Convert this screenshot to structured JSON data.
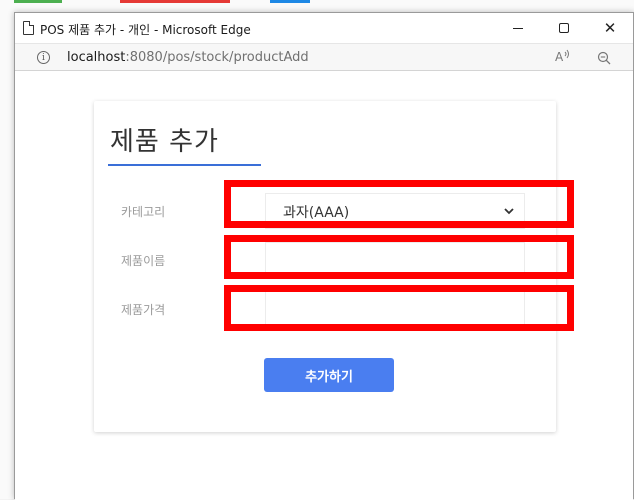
{
  "window": {
    "title": "POS 제품 추가 - 개인 - Microsoft Edge",
    "minimize_icon": "minimize-icon",
    "maximize_icon": "maximize-icon",
    "close_glyph": "✕"
  },
  "address": {
    "host": "localhost",
    "rest": ":8080/pos/stock/productAdd",
    "read_aloud_glyph": "A`",
    "info_glyph": "i"
  },
  "form": {
    "title": "제품 추가",
    "fields": [
      {
        "label": "카테고리",
        "type": "select",
        "value": "과자(AAA)"
      },
      {
        "label": "제품이름",
        "type": "text",
        "value": ""
      },
      {
        "label": "제품가격",
        "type": "text",
        "value": ""
      }
    ],
    "submit_label": "추가하기"
  },
  "colors": {
    "accent": "#3a6fd8",
    "button": "#4a7ef0",
    "annotation": "#ff0000"
  }
}
